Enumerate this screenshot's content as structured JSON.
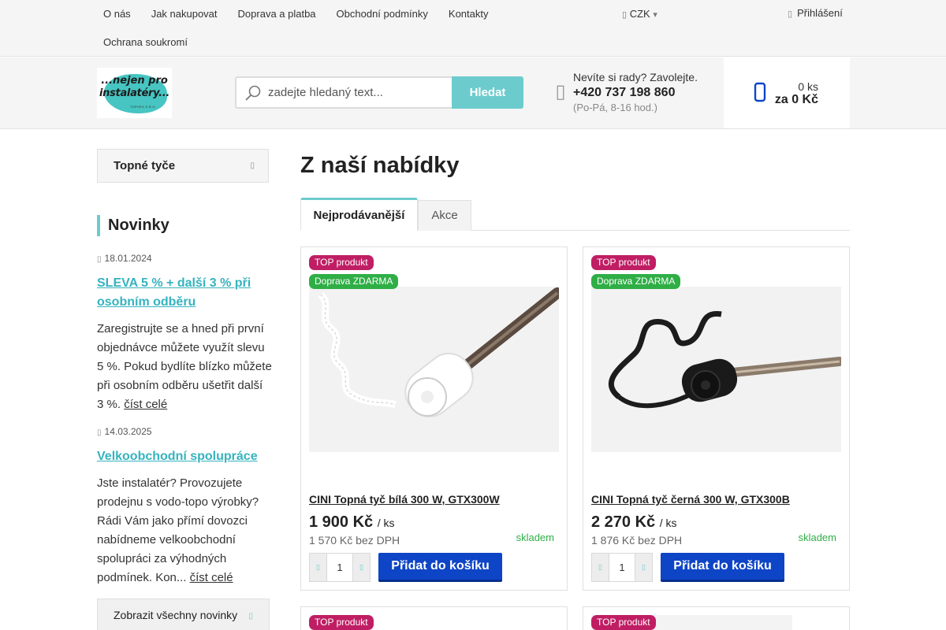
{
  "topbar": {
    "nav": [
      "O nás",
      "Jak nakupovat",
      "Doprava a platba",
      "Obchodní podmínky",
      "Kontakty",
      "Ochrana soukromí"
    ],
    "currency": "CZK",
    "login": "Přihlášení"
  },
  "header": {
    "logo": {
      "line1": "...nejen pro",
      "line2": "instalatéry...",
      "line3": "TOPVEX S.R.O."
    },
    "search": {
      "placeholder": "zadejte hledaný text...",
      "button": "Hledat"
    },
    "contact": {
      "question": "Nevíte si rady? Zavolejte.",
      "phone": "+420 737 198 860",
      "hours": "(Po-Pá, 8-16 hod.)"
    },
    "cart": {
      "count": "0 ks",
      "total": "za 0 Kč"
    }
  },
  "sidebar": {
    "category": "Topné tyče",
    "news_title": "Novinky",
    "news": [
      {
        "date": "18.01.2024",
        "title": "SLEVA 5 % + další 3 % při osobním odběru",
        "text": "Zaregistrujte se a hned při první objednávce můžete využít slevu 5 %. Pokud bydlíte blízko můžete při osobním odběru ušetřit další 3 %.",
        "more": "číst celé"
      },
      {
        "date": "14.03.2025",
        "title": "Velkoobchodní spolupráce",
        "text": "Jste instalatér? Provozujete prodejnu s vodo-topo výrobky? Rádi Vám jako přímí dovozci nabídneme velkoobchodní spolupráci za výhodných podmínek. Kon...",
        "more": "číst celé"
      }
    ],
    "all_news": "Zobrazit všechny novinky"
  },
  "main": {
    "title": "Z naší nabídky",
    "tabs": [
      "Nejprodávanější",
      "Akce"
    ],
    "products": [
      {
        "badges": [
          "TOP produkt",
          "Doprava ZDARMA"
        ],
        "name": "CINI Topná tyč bílá 300 W, GTX300W",
        "price": "1 900 Kč",
        "unit": "/ ks",
        "price_nett": "1 570 Kč bez DPH",
        "stock": "skladem",
        "qty": "1",
        "add": "Přidat do košíku"
      },
      {
        "badges": [
          "TOP produkt",
          "Doprava ZDARMA"
        ],
        "name": "CINI Topná tyč černá 300 W, GTX300B",
        "price": "2 270 Kč",
        "unit": "/ ks",
        "price_nett": "1 876 Kč bez DPH",
        "stock": "skladem",
        "qty": "1",
        "add": "Přidat do košíku"
      },
      {
        "badges": [
          "TOP produkt"
        ]
      },
      {
        "badges": [
          "TOP produkt"
        ]
      }
    ]
  },
  "colors": {
    "accent": "#6ccbcd",
    "link": "#35b3bf",
    "badge_top": "#c01e64",
    "badge_free": "#2fae46",
    "add_button": "#0e45c6",
    "stock": "#2fae46"
  },
  "icons": [
    "user-icon",
    "chevron-down-icon",
    "search-icon",
    "phone-icon",
    "cart-icon",
    "calendar-icon",
    "chevron-right-icon",
    "minus-icon",
    "plus-icon"
  ]
}
